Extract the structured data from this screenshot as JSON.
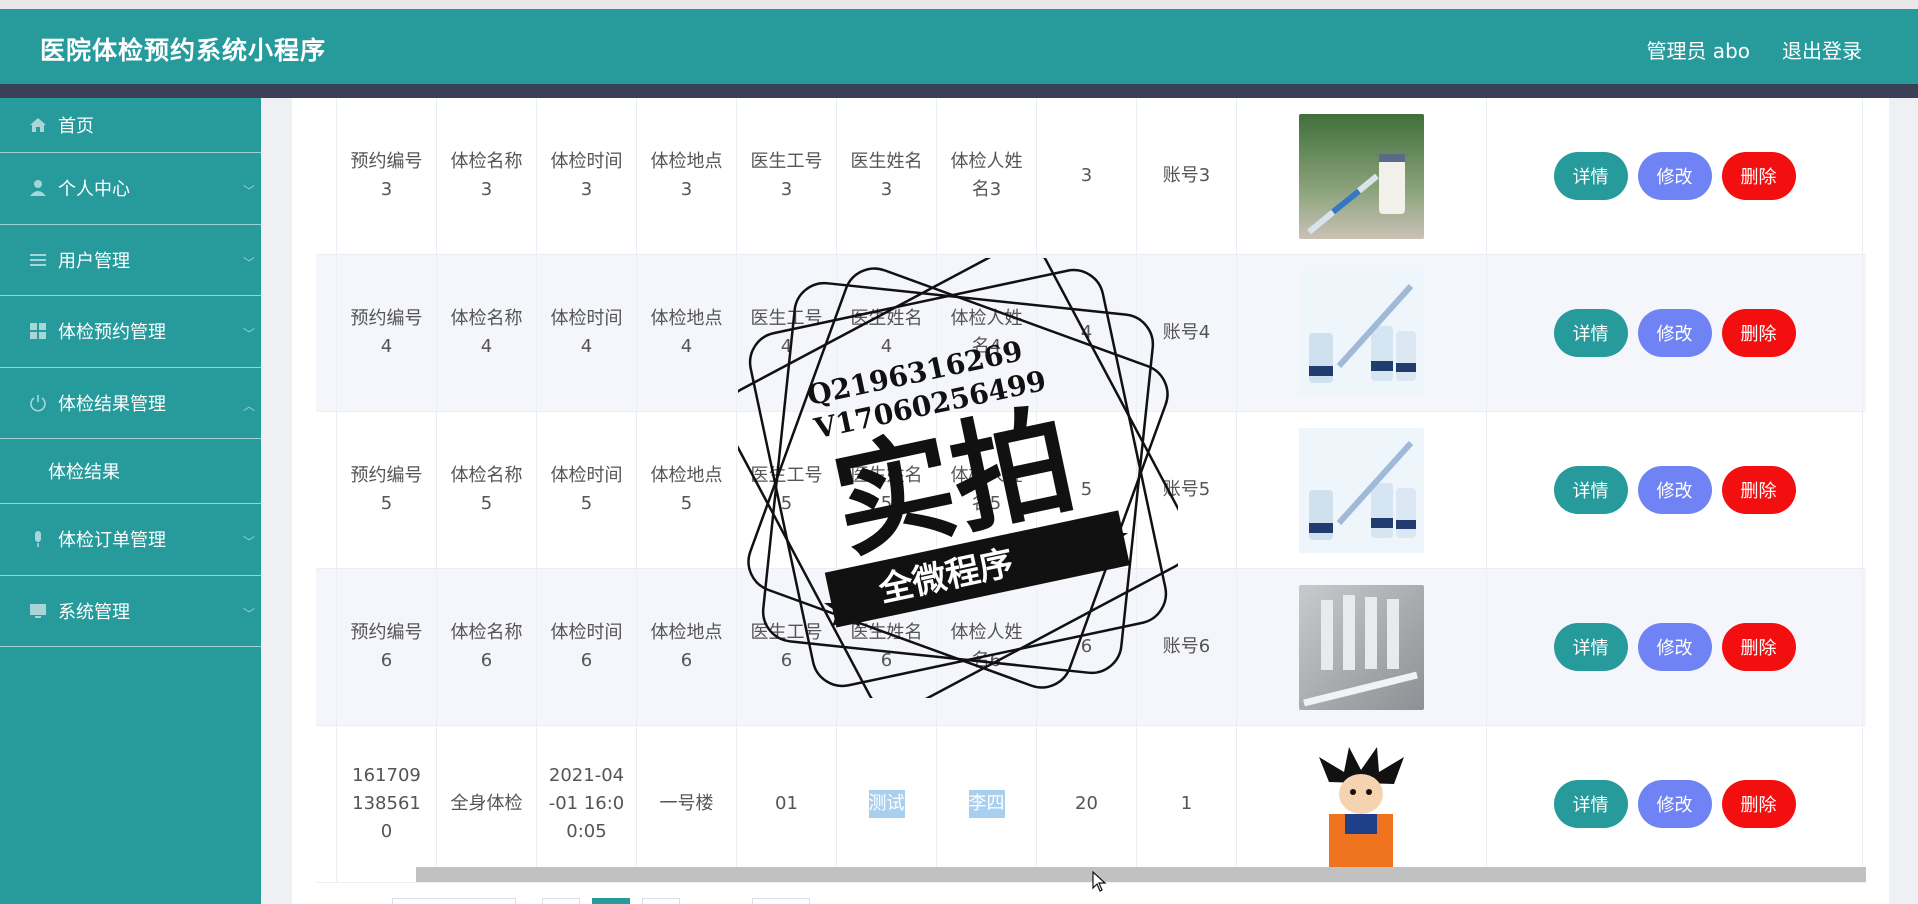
{
  "header": {
    "title": "医院体检预约系统小程序",
    "user_label": "管理员 abo",
    "logout_label": "退出登录"
  },
  "sidebar": {
    "items": [
      {
        "label": "首页",
        "icon": "home-icon"
      },
      {
        "label": "个人中心",
        "icon": "person-icon"
      },
      {
        "label": "用户管理",
        "icon": "list-icon"
      },
      {
        "label": "体检预约管理",
        "icon": "grid-icon"
      },
      {
        "label": "体检结果管理",
        "icon": "power-icon",
        "sub": "体检结果"
      },
      {
        "label": "体检订单管理",
        "icon": "mic-icon"
      },
      {
        "label": "系统管理",
        "icon": "monitor-icon"
      }
    ]
  },
  "table": {
    "rows": [
      {
        "c1": "预约编号3",
        "c2": "体检名称3",
        "c3": "体检时间3",
        "c4": "体检地点3",
        "c5": "医生工号3",
        "c6": "医生姓名3",
        "c7": "体检人姓名3",
        "c8": "3",
        "c9": "账号3",
        "img": "syringe-vial"
      },
      {
        "c1": "预约编号4",
        "c2": "体检名称4",
        "c3": "体检时间4",
        "c4": "体检地点4",
        "c5": "医生工号4",
        "c6": "医生姓名4",
        "c7": "体检人姓名4",
        "c8": "4",
        "c9": "账号4",
        "img": "vials-blue"
      },
      {
        "c1": "预约编号5",
        "c2": "体检名称5",
        "c3": "体检时间5",
        "c4": "体检地点5",
        "c5": "医生工号5",
        "c6": "医生姓名5",
        "c7": "体检人姓名5",
        "c8": "5",
        "c9": "账号5",
        "img": "vials-blue"
      },
      {
        "c1": "预约编号6",
        "c2": "体检名称6",
        "c3": "体检时间6",
        "c4": "体检地点6",
        "c5": "医生工号6",
        "c6": "医生姓名6",
        "c7": "体检人姓名6",
        "c8": "6",
        "c9": "账号6",
        "img": "vials-grey"
      },
      {
        "c1": "1617091385610",
        "c2": "全身体检",
        "c3": "2021-04-01 16:00:05",
        "c4": "一号楼",
        "c5": "01",
        "c6": "测试",
        "c7": "李四",
        "c8": "20",
        "c9": "1",
        "img": "cartoon"
      }
    ],
    "buttons": {
      "detail": "详情",
      "edit": "修改",
      "delete": "删除"
    }
  },
  "watermark": {
    "line1": "Q2196316269",
    "line2": "V17060256499",
    "big": "实拍",
    "banner": "全微程序"
  },
  "colors": {
    "primary": "#279a9c",
    "edit": "#6f83f4",
    "delete": "#f30f0f"
  }
}
